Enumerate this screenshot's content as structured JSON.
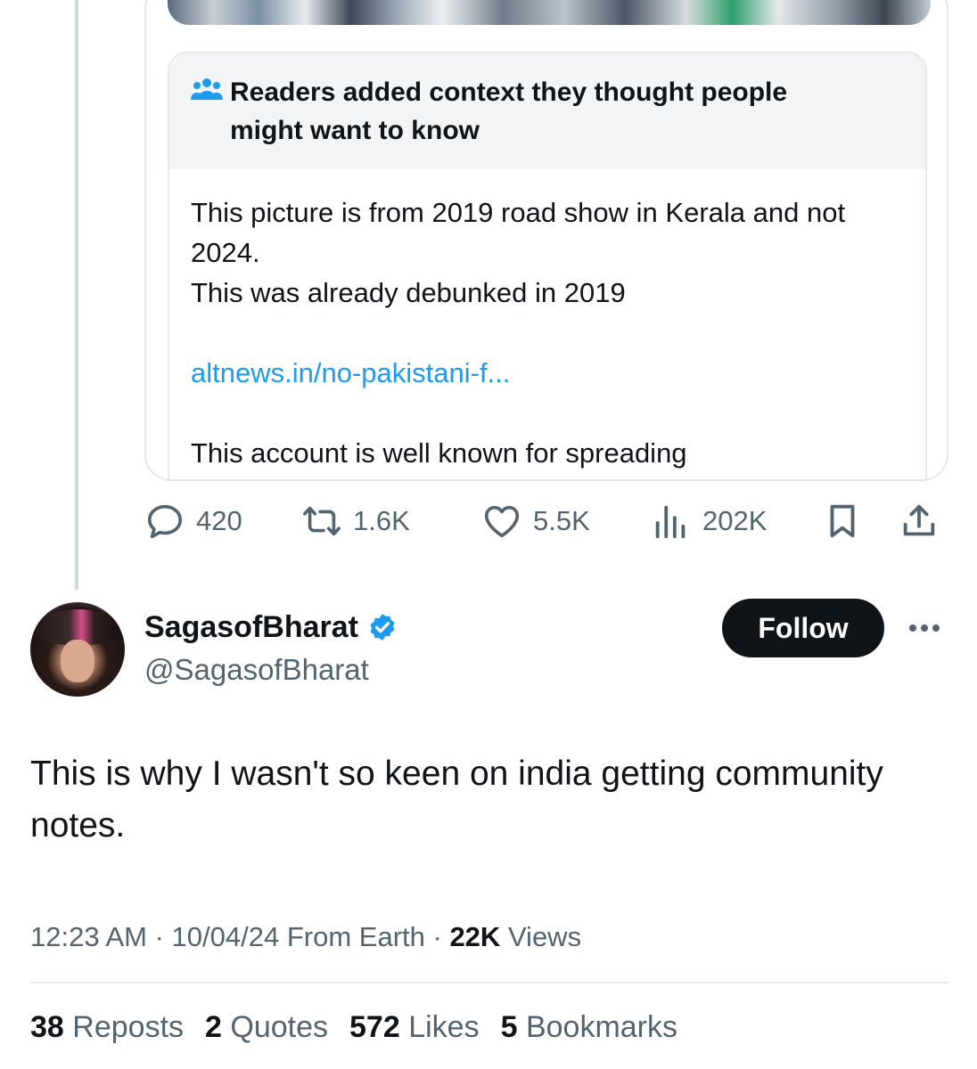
{
  "community_note": {
    "heading": "Readers added context they thought people might want to know",
    "icon": "people-icon",
    "body_line1": "This picture is from 2019 road show in Kerala and not 2024.",
    "body_line2": "This was already debunked in 2019",
    "link": "altnews.in/no-pakistani-f...",
    "body_line3": "This account is well known for spreading",
    "colors": {
      "header_bg": "#f2f4f5",
      "link": "#1d9bf0"
    }
  },
  "quoted_actions": {
    "replies": "420",
    "reposts": "1.6K",
    "likes": "5.5K",
    "views": "202K"
  },
  "author": {
    "display_name": "SagasofBharat",
    "handle": "@SagasofBharat",
    "verified": true,
    "follow_label": "Follow"
  },
  "tweet": {
    "text": "This is why I wasn't so keen on india getting community notes.",
    "time": "12:23 AM",
    "date": "10/04/24",
    "source": "From Earth",
    "views_count": "22K",
    "views_label": "Views"
  },
  "stats": [
    {
      "count": "38",
      "label": "Reposts"
    },
    {
      "count": "2",
      "label": "Quotes"
    },
    {
      "count": "572",
      "label": "Likes"
    },
    {
      "count": "5",
      "label": "Bookmarks"
    }
  ],
  "colors": {
    "text": "#0f1419",
    "secondary": "#536471",
    "verified": "#1d9bf0",
    "follow_bg": "#0f1419"
  }
}
